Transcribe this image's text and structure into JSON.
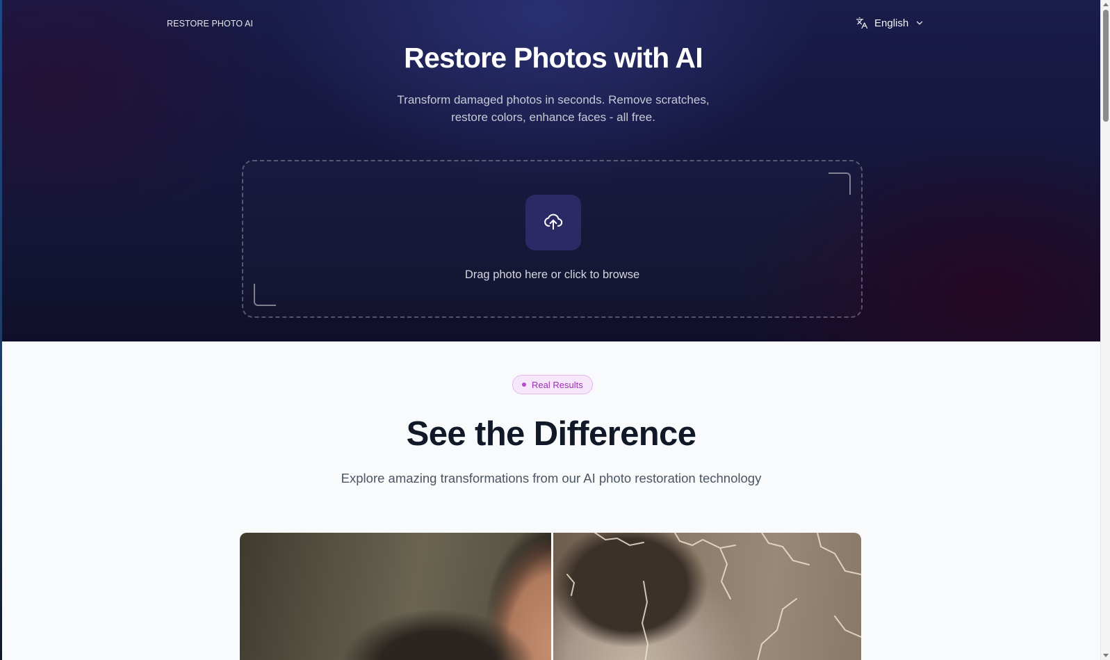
{
  "header": {
    "brand": "RESTORE PHOTO AI",
    "language": "English",
    "language_icon": "translate-icon"
  },
  "hero": {
    "title": "Restore Photos with AI",
    "subtitle": "Transform damaged photos in seconds. Remove scratches, restore colors, enhance faces - all free.",
    "dropzone_text": "Drag photo here or click to browse",
    "upload_icon": "cloud-upload-icon"
  },
  "results": {
    "badge": "Real Results",
    "title": "See the Difference",
    "subtitle": "Explore amazing transformations from our AI photo restoration technology"
  },
  "colors": {
    "hero_bg": "#16173e",
    "accent_purple": "#9b2fb5",
    "badge_bg": "#f7e7fb",
    "upload_tile": "#2c2967",
    "page_bg": "#f8fafc"
  }
}
